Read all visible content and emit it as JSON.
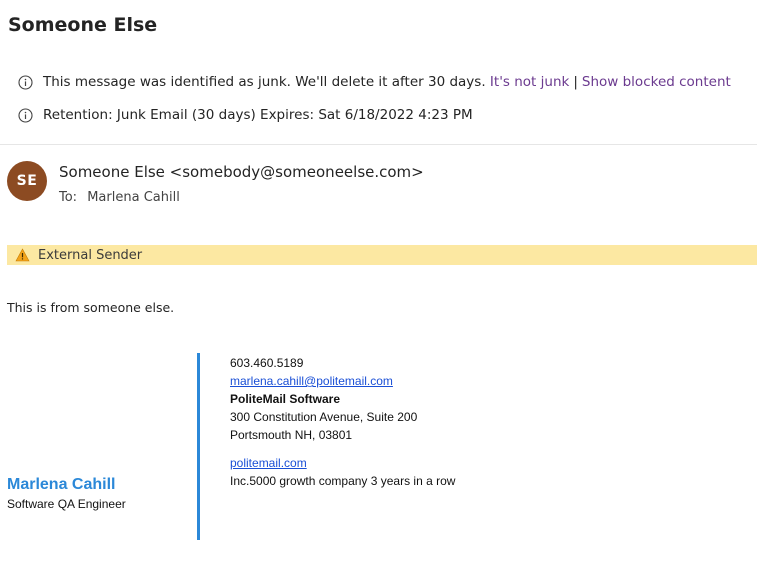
{
  "email": {
    "subject": "Someone Else",
    "junk_notice": {
      "icon": "info-icon",
      "text": "This message was identified as junk. We'll delete it after 30 days.",
      "not_junk_link": "It's not junk",
      "separator": "|",
      "show_blocked_link": "Show blocked content"
    },
    "retention_notice": {
      "icon": "info-icon",
      "text": "Retention: Junk Email (30 days) Expires: Sat 6/18/2022 4:23 PM"
    },
    "sender": {
      "avatar_initials": "SE",
      "avatar_color": "#8c4b22",
      "display": "Someone Else <somebody@someoneelse.com>"
    },
    "recipients": {
      "label": "To:",
      "value": "Marlena Cahill"
    },
    "external_banner": {
      "icon": "warning-icon",
      "text": "External Sender",
      "color": "#fce8a2"
    },
    "body": "This is from someone else."
  },
  "signature": {
    "name": "Marlena Cahill",
    "title": "Software QA Engineer",
    "accent_color": "#2b88d8",
    "phone": "603.460.5189",
    "email": "marlena.cahill@politemail.com",
    "company": "PoliteMail Software",
    "address_line1": "300 Constitution Avenue, Suite 200",
    "address_line2": "Portsmouth NH, 03801",
    "website": "politemail.com",
    "tagline": "Inc.5000 growth company 3 years in a row"
  }
}
